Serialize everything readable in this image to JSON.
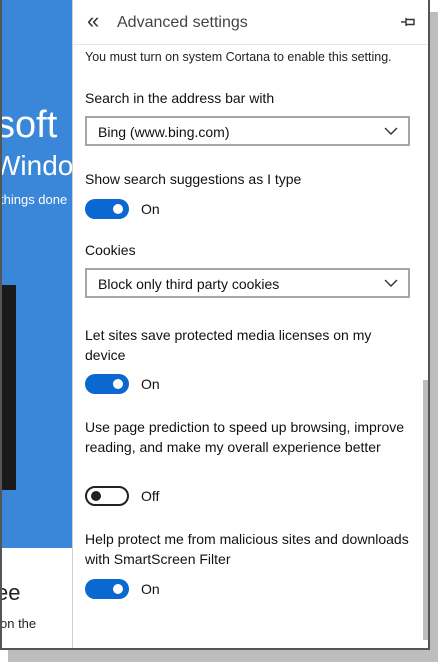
{
  "background": {
    "heading": "soft",
    "subheading": "Windo",
    "tagline": "things done",
    "footer_heading": "ee",
    "footer_text": "on the"
  },
  "panel": {
    "title": "Advanced settings",
    "back_icon": "double-chevron-left-icon",
    "pin_icon": "pin-icon",
    "cortana_note": "You must turn on system Cortana to enable this setting.",
    "search_engine": {
      "label": "Search in the address bar with",
      "value": "Bing (www.bing.com)"
    },
    "suggestions": {
      "label": "Show search suggestions as I type",
      "state": "On"
    },
    "cookies": {
      "label": "Cookies",
      "value": "Block only third party cookies"
    },
    "media_licenses": {
      "label": "Let sites save protected media licenses on my device",
      "state": "On"
    },
    "page_prediction": {
      "label": "Use page prediction to speed up browsing, improve reading, and make my overall experience better",
      "state": "Off"
    },
    "smartscreen": {
      "label": "Help protect me from malicious sites and downloads with SmartScreen Filter",
      "state": "On"
    }
  },
  "colors": {
    "accent": "#0a68d0",
    "page_blue": "#3a86d9"
  }
}
